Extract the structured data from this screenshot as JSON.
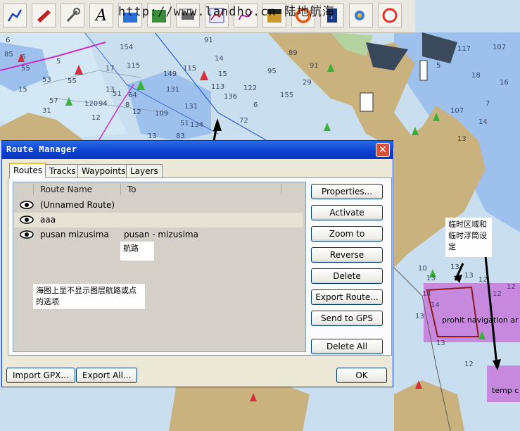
{
  "toolbar": {
    "watermark": "http://www.landho.cn 陆地航海",
    "icons": [
      "route-icon",
      "boat-icon",
      "wrench-icon",
      "text-tool-icon",
      "layer-icon",
      "chart-download-icon",
      "printer-icon",
      "chart-view-icon",
      "curve-icon",
      "layer-color-icon",
      "lifebuoy-icon",
      "info-icon",
      "gps-icon",
      "lifering-icon"
    ]
  },
  "chart": {
    "depths": [
      "85",
      "6",
      "6",
      "14",
      "15",
      "154",
      "131",
      "136",
      "155",
      "122",
      "131",
      "113",
      "115",
      "149",
      "95",
      "89",
      "91",
      "29",
      "6",
      "72",
      "134",
      "91",
      "115",
      "17",
      "13",
      "94",
      "12",
      "12",
      "109",
      "51",
      "64",
      "8",
      "120",
      "55",
      "53",
      "57",
      "5",
      "55",
      "51",
      "83",
      "13",
      "31",
      "15",
      "117",
      "107",
      "18",
      "7",
      "13",
      "5",
      "107",
      "16",
      "14",
      "10",
      "13",
      "14",
      "14",
      "13",
      "13",
      "12",
      "12",
      "12",
      "13",
      "13",
      "12"
    ],
    "labels": {
      "prohibit": "prohit navigation ar",
      "temp": "temp c"
    }
  },
  "dialog": {
    "title": "Route Manager",
    "tabs": [
      "Routes",
      "Tracks",
      "Waypoints",
      "Layers"
    ],
    "columns": {
      "name": "Route Name",
      "to": "To"
    },
    "routes": [
      {
        "name": "(Unnamed Route)",
        "to": ""
      },
      {
        "name": "aaa",
        "to": ""
      },
      {
        "name": "pusan mizusima",
        "to": "pusan - mizusima"
      }
    ],
    "buttons": {
      "properties": "Properties...",
      "activate": "Activate",
      "zoom": "Zoom to",
      "reverse": "Reverse",
      "delete": "Delete",
      "export_route": "Export Route...",
      "send_gps": "Send to GPS",
      "delete_all": "Delete All",
      "import_gpx": "Import GPX...",
      "export_all": "Export All...",
      "ok": "OK"
    }
  },
  "annotations": {
    "route_label": "航路",
    "visibility_note": "海图上显不显示图层航路或点的选项",
    "temp_area_note": "临时区域和临时浮筒设定"
  }
}
